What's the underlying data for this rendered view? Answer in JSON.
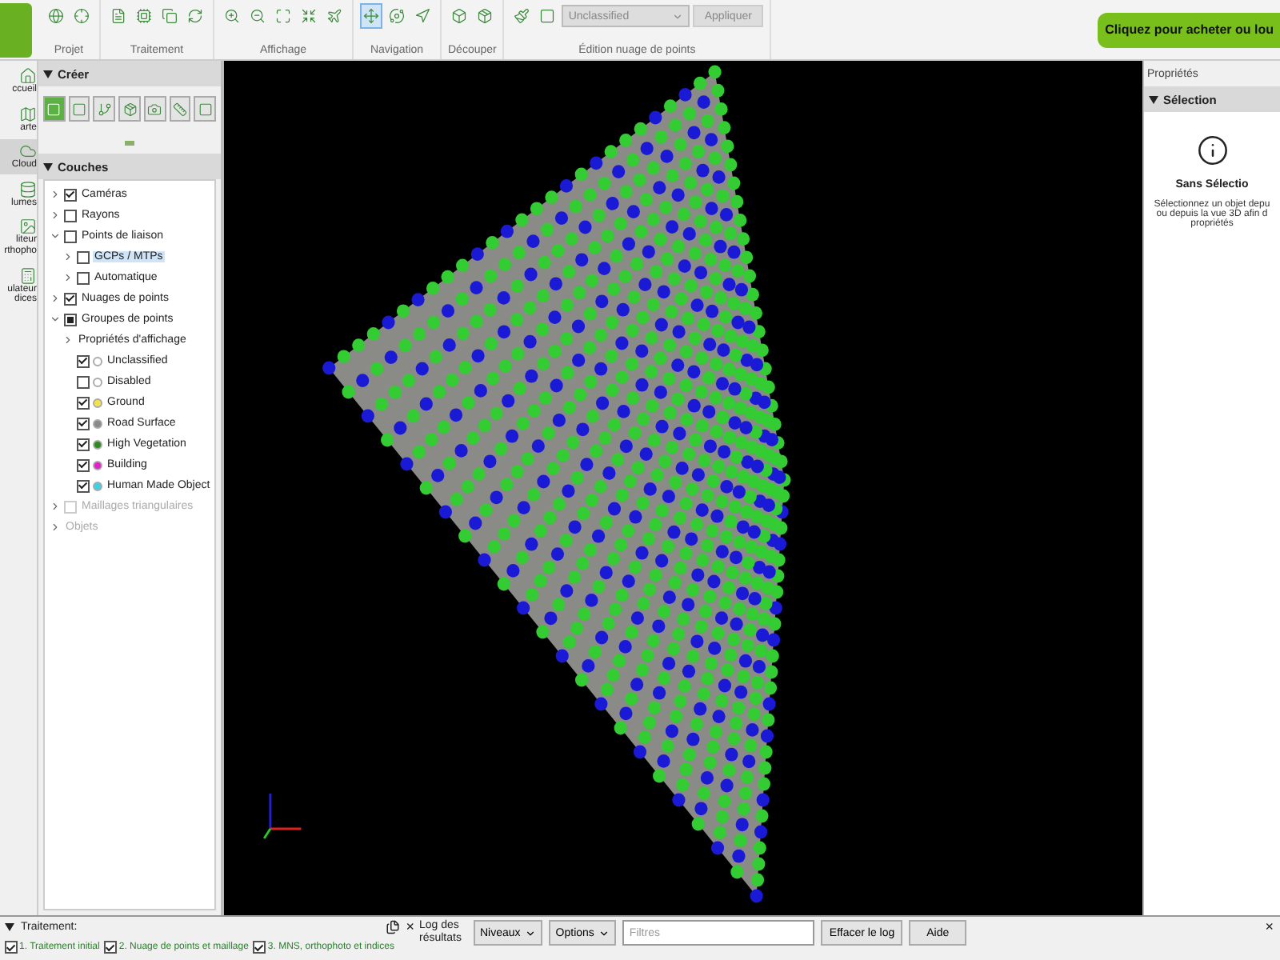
{
  "toolbar": {
    "groups": [
      {
        "label": "Projet",
        "tools": [
          {
            "selected": false
          },
          {
            "selected": false
          }
        ]
      },
      {
        "label": "Traitement",
        "tools": [
          {
            "selected": false
          },
          {
            "selected": false
          },
          {
            "selected": false
          },
          {
            "selected": false
          }
        ]
      },
      {
        "label": "Affichage",
        "tools": [
          {
            "selected": false
          },
          {
            "selected": false
          },
          {
            "selected": false
          },
          {
            "selected": false
          },
          {
            "selected": false
          }
        ]
      },
      {
        "label": "Navigation",
        "tools": [
          {
            "selected": true
          },
          {
            "selected": false
          },
          {
            "selected": false
          }
        ]
      },
      {
        "label": "Découper",
        "tools": [
          {
            "selected": false
          },
          {
            "selected": false
          }
        ]
      }
    ],
    "edit": {
      "label": "Édition nuage de points",
      "class_value": "Unclassified",
      "apply": "Appliquer"
    },
    "buy_button": "Cliquez pour acheter ou lou"
  },
  "rail": [
    {
      "label": "ccueil",
      "selected": false
    },
    {
      "label": "arte",
      "selected": false
    },
    {
      "label": "Cloud",
      "selected": true
    },
    {
      "label": "lumes",
      "selected": false
    },
    {
      "label": "liteur rthopho",
      "selected": false
    },
    {
      "label": "ulateur dices",
      "selected": false
    }
  ],
  "create": {
    "title": "Créer",
    "tools": [
      {
        "selected": true
      },
      {
        "selected": false
      },
      {
        "selected": false
      },
      {
        "selected": false
      },
      {
        "selected": false
      },
      {
        "selected": false
      },
      {
        "selected": false
      }
    ]
  },
  "layers": {
    "title": "Couches",
    "items": [
      {
        "label": "Caméras",
        "checked": true,
        "expanded": false,
        "selected": false,
        "disabled": false
      },
      {
        "label": "Rayons",
        "checked": false,
        "expanded": false,
        "selected": false,
        "disabled": false
      },
      {
        "label": "Points de liaison",
        "checked": false,
        "expanded": true,
        "selected": false,
        "disabled": false,
        "children": [
          {
            "label": "GCPs / MTPs",
            "checked": false,
            "expanded": false,
            "selected": true,
            "disabled": false
          },
          {
            "label": "Automatique",
            "checked": false,
            "expanded": false,
            "selected": false,
            "disabled": false
          }
        ]
      },
      {
        "label": "Nuages de points",
        "checked": true,
        "expanded": false,
        "selected": false,
        "disabled": false
      },
      {
        "label": "Groupes de points",
        "partial": true,
        "expanded": true,
        "selected": false,
        "disabled": false,
        "children": [
          {
            "label": "Propriétés d'affichage",
            "expanded": false,
            "selected": false,
            "disabled": false
          },
          {
            "label": "Unclassified",
            "checked": true,
            "color": "#ffffff",
            "selected": false,
            "disabled": false
          },
          {
            "label": "Disabled",
            "checked": false,
            "color": "#ffffff",
            "selected": false,
            "disabled": false
          },
          {
            "label": "Ground",
            "checked": true,
            "color": "#f2e34a",
            "selected": false,
            "disabled": false
          },
          {
            "label": "Road Surface",
            "checked": true,
            "color": "#8a8a8a",
            "selected": false,
            "disabled": false
          },
          {
            "label": "High Vegetation",
            "checked": true,
            "color": "#2e8b1e",
            "selected": false,
            "disabled": false
          },
          {
            "label": "Building",
            "checked": true,
            "color": "#e61ec8",
            "selected": false,
            "disabled": false
          },
          {
            "label": "Human Made Object",
            "checked": true,
            "color": "#3cd2e6",
            "selected": false,
            "disabled": false
          }
        ]
      },
      {
        "label": "Maillages triangulaires",
        "checked": false,
        "expanded": false,
        "selected": false,
        "disabled": true
      },
      {
        "label": "Objets",
        "expanded": false,
        "selected": false,
        "disabled": true
      }
    ]
  },
  "properties": {
    "title": "Propriétés",
    "section": "Sélection",
    "heading": "Sans Sélectio",
    "lines": [
      "Sélectionnez un objet depu",
      "ou depuis la vue 3D afin d",
      "propriétés"
    ]
  },
  "processing": {
    "title": "Traitement:",
    "close": "×",
    "steps": [
      {
        "label": "1. Traitement initial",
        "checked": true
      },
      {
        "label": "2. Nuage de points et maillage",
        "checked": true
      },
      {
        "label": "3. MNS, orthophoto et indices",
        "checked": true
      }
    ]
  },
  "log": {
    "title": "Log des résultats",
    "levels": "Niveaux",
    "options": "Options",
    "filter_placeholder": "Filtres",
    "clear": "Effacer le log",
    "help": "Aide",
    "close": "×"
  }
}
